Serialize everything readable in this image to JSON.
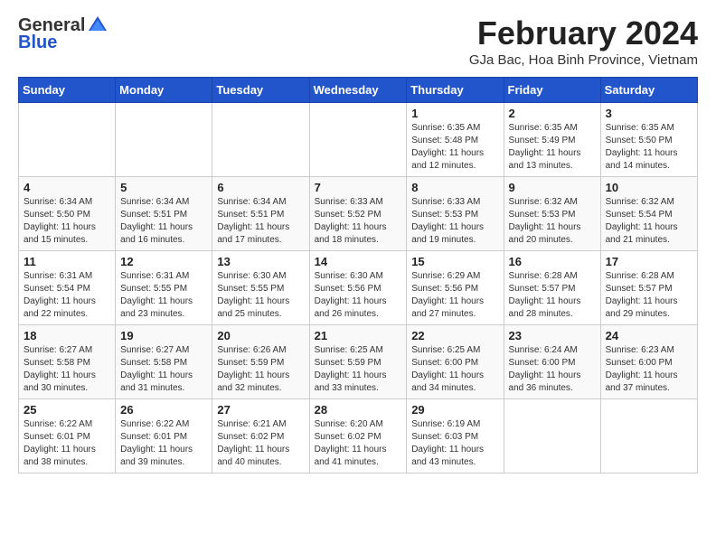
{
  "header": {
    "logo_general": "General",
    "logo_blue": "Blue",
    "month_title": "February 2024",
    "subtitle": "GJa Bac, Hoa Binh Province, Vietnam"
  },
  "weekdays": [
    "Sunday",
    "Monday",
    "Tuesday",
    "Wednesday",
    "Thursday",
    "Friday",
    "Saturday"
  ],
  "weeks": [
    [
      {
        "day": "",
        "info": ""
      },
      {
        "day": "",
        "info": ""
      },
      {
        "day": "",
        "info": ""
      },
      {
        "day": "",
        "info": ""
      },
      {
        "day": "1",
        "info": "Sunrise: 6:35 AM\nSunset: 5:48 PM\nDaylight: 11 hours\nand 12 minutes."
      },
      {
        "day": "2",
        "info": "Sunrise: 6:35 AM\nSunset: 5:49 PM\nDaylight: 11 hours\nand 13 minutes."
      },
      {
        "day": "3",
        "info": "Sunrise: 6:35 AM\nSunset: 5:50 PM\nDaylight: 11 hours\nand 14 minutes."
      }
    ],
    [
      {
        "day": "4",
        "info": "Sunrise: 6:34 AM\nSunset: 5:50 PM\nDaylight: 11 hours\nand 15 minutes."
      },
      {
        "day": "5",
        "info": "Sunrise: 6:34 AM\nSunset: 5:51 PM\nDaylight: 11 hours\nand 16 minutes."
      },
      {
        "day": "6",
        "info": "Sunrise: 6:34 AM\nSunset: 5:51 PM\nDaylight: 11 hours\nand 17 minutes."
      },
      {
        "day": "7",
        "info": "Sunrise: 6:33 AM\nSunset: 5:52 PM\nDaylight: 11 hours\nand 18 minutes."
      },
      {
        "day": "8",
        "info": "Sunrise: 6:33 AM\nSunset: 5:53 PM\nDaylight: 11 hours\nand 19 minutes."
      },
      {
        "day": "9",
        "info": "Sunrise: 6:32 AM\nSunset: 5:53 PM\nDaylight: 11 hours\nand 20 minutes."
      },
      {
        "day": "10",
        "info": "Sunrise: 6:32 AM\nSunset: 5:54 PM\nDaylight: 11 hours\nand 21 minutes."
      }
    ],
    [
      {
        "day": "11",
        "info": "Sunrise: 6:31 AM\nSunset: 5:54 PM\nDaylight: 11 hours\nand 22 minutes."
      },
      {
        "day": "12",
        "info": "Sunrise: 6:31 AM\nSunset: 5:55 PM\nDaylight: 11 hours\nand 23 minutes."
      },
      {
        "day": "13",
        "info": "Sunrise: 6:30 AM\nSunset: 5:55 PM\nDaylight: 11 hours\nand 25 minutes."
      },
      {
        "day": "14",
        "info": "Sunrise: 6:30 AM\nSunset: 5:56 PM\nDaylight: 11 hours\nand 26 minutes."
      },
      {
        "day": "15",
        "info": "Sunrise: 6:29 AM\nSunset: 5:56 PM\nDaylight: 11 hours\nand 27 minutes."
      },
      {
        "day": "16",
        "info": "Sunrise: 6:28 AM\nSunset: 5:57 PM\nDaylight: 11 hours\nand 28 minutes."
      },
      {
        "day": "17",
        "info": "Sunrise: 6:28 AM\nSunset: 5:57 PM\nDaylight: 11 hours\nand 29 minutes."
      }
    ],
    [
      {
        "day": "18",
        "info": "Sunrise: 6:27 AM\nSunset: 5:58 PM\nDaylight: 11 hours\nand 30 minutes."
      },
      {
        "day": "19",
        "info": "Sunrise: 6:27 AM\nSunset: 5:58 PM\nDaylight: 11 hours\nand 31 minutes."
      },
      {
        "day": "20",
        "info": "Sunrise: 6:26 AM\nSunset: 5:59 PM\nDaylight: 11 hours\nand 32 minutes."
      },
      {
        "day": "21",
        "info": "Sunrise: 6:25 AM\nSunset: 5:59 PM\nDaylight: 11 hours\nand 33 minutes."
      },
      {
        "day": "22",
        "info": "Sunrise: 6:25 AM\nSunset: 6:00 PM\nDaylight: 11 hours\nand 34 minutes."
      },
      {
        "day": "23",
        "info": "Sunrise: 6:24 AM\nSunset: 6:00 PM\nDaylight: 11 hours\nand 36 minutes."
      },
      {
        "day": "24",
        "info": "Sunrise: 6:23 AM\nSunset: 6:00 PM\nDaylight: 11 hours\nand 37 minutes."
      }
    ],
    [
      {
        "day": "25",
        "info": "Sunrise: 6:22 AM\nSunset: 6:01 PM\nDaylight: 11 hours\nand 38 minutes."
      },
      {
        "day": "26",
        "info": "Sunrise: 6:22 AM\nSunset: 6:01 PM\nDaylight: 11 hours\nand 39 minutes."
      },
      {
        "day": "27",
        "info": "Sunrise: 6:21 AM\nSunset: 6:02 PM\nDaylight: 11 hours\nand 40 minutes."
      },
      {
        "day": "28",
        "info": "Sunrise: 6:20 AM\nSunset: 6:02 PM\nDaylight: 11 hours\nand 41 minutes."
      },
      {
        "day": "29",
        "info": "Sunrise: 6:19 AM\nSunset: 6:03 PM\nDaylight: 11 hours\nand 43 minutes."
      },
      {
        "day": "",
        "info": ""
      },
      {
        "day": "",
        "info": ""
      }
    ]
  ]
}
